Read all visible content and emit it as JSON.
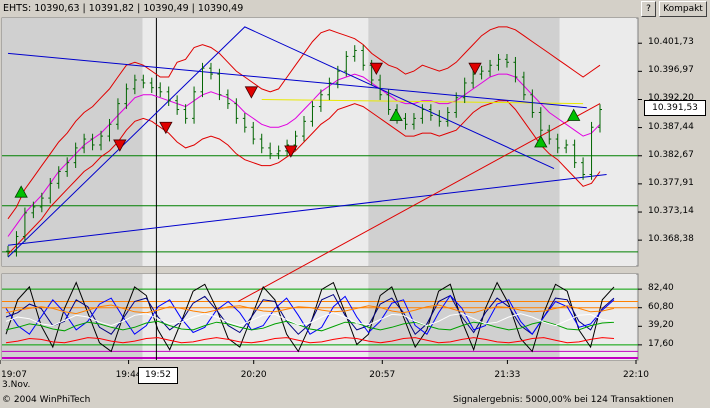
{
  "header": {
    "quote_text": "EHTS: 10390,63 | 10391,82 | 10390,49 | 10390,49",
    "help_label": "?",
    "compact_label": "Kompakt"
  },
  "price_marker": "10.391,53",
  "cursor_time": "19:52",
  "footer": {
    "date": "3.Nov.",
    "copyright": "© 2004 WinPhiTech",
    "signal_result": "Signalergebnis: 5000,00% bei 124 Transaktionen"
  },
  "colors": {
    "price_bars": "#006400",
    "bollinger": "#e00000",
    "trend": "#0000cc",
    "ma": "#e000e0",
    "buy_signal": "#00c000",
    "sell_signal": "#e00000"
  },
  "chart_data": {
    "type": "ohlc",
    "title": "",
    "xlabel": "",
    "ylabel": "",
    "x_ticks": [
      "19:07",
      "19:44",
      "20:20",
      "20:57",
      "21:33",
      "22:10"
    ],
    "y_ticks": [
      10401.73,
      10396.97,
      10392.2,
      10387.44,
      10382.67,
      10377.91,
      10373.14,
      10368.38
    ],
    "y_tick_labels": [
      "10.401,73",
      "10.396,97",
      "10.392,20",
      "10.387,44",
      "10.382,67",
      "10.377,91",
      "10.373,14",
      "10.368,38"
    ],
    "ylim": [
      10364.0,
      10406.0
    ],
    "sessions": [
      {
        "from": "19:07",
        "to": "19:48",
        "shade": "grey"
      },
      {
        "from": "19:48",
        "to": "20:53",
        "shade": "light"
      },
      {
        "from": "20:53",
        "to": "21:48",
        "shade": "grey"
      },
      {
        "from": "21:48",
        "to": "22:10",
        "shade": "light"
      }
    ],
    "cursor_x": "19:52",
    "price_series": [
      10366.5,
      10369,
      10373,
      10374,
      10375.5,
      10378,
      10380,
      10381.5,
      10384,
      10385.5,
      10384.5,
      10386,
      10388,
      10391.5,
      10394,
      10395.5,
      10395,
      10394.2,
      10393.5,
      10392,
      10390.5,
      10389,
      10393.5,
      10397.5,
      10396.5,
      10393,
      10391.5,
      10389,
      10387.5,
      10385.5,
      10384,
      10383,
      10383.5,
      10384.5,
      10386,
      10388.5,
      10391,
      10393,
      10395,
      10397,
      10399.5,
      10400.5,
      10398,
      10395.5,
      10393,
      10390.5,
      10389,
      10388,
      10389,
      10390.5,
      10389.5,
      10388.5,
      10390,
      10392.5,
      10395,
      10396.5,
      10397,
      10398,
      10399,
      10398.5,
      10396,
      10393,
      10390,
      10387,
      10385.5,
      10384,
      10384.5,
      10381.5,
      10379.5,
      10387.5,
      10390.5
    ],
    "bollinger_upper": [
      10372,
      10374,
      10377,
      10379,
      10381,
      10383,
      10385,
      10386.5,
      10388.5,
      10390,
      10391,
      10392.5,
      10394,
      10396,
      10398,
      10398.5,
      10398,
      10397,
      10396,
      10396,
      10398.5,
      10399,
      10401,
      10401.5,
      10401,
      10400,
      10398.5,
      10397,
      10396,
      10395,
      10394,
      10393.5,
      10394,
      10396,
      10398,
      10400,
      10402,
      10403.5,
      10404,
      10403.5,
      10403,
      10402.5,
      10401.5,
      10400,
      10399,
      10398,
      10397.5,
      10396.5,
      10397,
      10398,
      10397.5,
      10397,
      10397.5,
      10398.5,
      10400,
      10401.5,
      10403,
      10404,
      10404.5,
      10404.5,
      10404,
      10403,
      10402,
      10401,
      10400,
      10399,
      10398,
      10397,
      10396,
      10397,
      10398
    ],
    "bollinger_lower": [
      10366,
      10367.5,
      10369,
      10370.5,
      10372,
      10374,
      10375.5,
      10377,
      10378.5,
      10380,
      10381,
      10382.5,
      10383.5,
      10385,
      10387,
      10388.5,
      10389,
      10388.5,
      10387.5,
      10386.5,
      10385,
      10384,
      10384.5,
      10385.5,
      10386,
      10385.5,
      10384.5,
      10383,
      10382,
      10381.5,
      10381,
      10381,
      10381.5,
      10382.5,
      10383.5,
      10385,
      10386.5,
      10388,
      10389,
      10390.5,
      10391,
      10391.5,
      10391,
      10390,
      10389,
      10388,
      10387,
      10386,
      10386,
      10386.5,
      10386.5,
      10386,
      10386.5,
      10387,
      10388.5,
      10390,
      10391,
      10391.5,
      10392,
      10392,
      10390.5,
      10388.5,
      10386.5,
      10384.5,
      10383,
      10382,
      10380.5,
      10379,
      10377.5,
      10378,
      10380
    ],
    "moving_average": [
      10369,
      10371,
      10373,
      10374.5,
      10376,
      10378,
      10380,
      10381.5,
      10383,
      10384.5,
      10385.5,
      10386.5,
      10388,
      10389.5,
      10391,
      10392.5,
      10393,
      10393,
      10392.5,
      10392,
      10391.5,
      10391,
      10392,
      10393,
      10393.5,
      10393,
      10392.5,
      10391.5,
      10390,
      10389,
      10388,
      10387.5,
      10387.5,
      10388,
      10389,
      10390.5,
      10392,
      10393.5,
      10394.5,
      10395.5,
      10396,
      10396.5,
      10396,
      10395,
      10394,
      10393,
      10392,
      10391.5,
      10391.5,
      10392,
      10392,
      10391.5,
      10391.5,
      10392,
      10393,
      10394,
      10395,
      10396,
      10396.5,
      10396.5,
      10396,
      10394.5,
      10393,
      10391.5,
      10390,
      10389,
      10388,
      10387,
      10386,
      10386.5,
      10388
    ],
    "trend_lines": [
      {
        "color": "trend",
        "points": [
          [
            0,
            10365.5
          ],
          [
            36,
            10404.5
          ],
          [
            83,
            10380.5
          ]
        ]
      },
      {
        "color": "trend",
        "points": [
          [
            0,
            10400
          ],
          [
            88,
            10390.8
          ]
        ]
      },
      {
        "color": "trend",
        "points": [
          [
            0,
            10367.5
          ],
          [
            91,
            10379.5
          ]
        ]
      },
      {
        "color": "bollinger",
        "points": [
          [
            35,
            10358
          ],
          [
            90,
            10391.5
          ]
        ]
      }
    ],
    "signals": [
      {
        "type": "buy",
        "idx": 2,
        "price": 10376.5
      },
      {
        "type": "sell",
        "idx": 17,
        "price": 10384.5
      },
      {
        "type": "sell",
        "idx": 24,
        "price": 10387.5
      },
      {
        "type": "sell",
        "idx": 37,
        "price": 10393.5
      },
      {
        "type": "sell",
        "idx": 43,
        "price": 10383.5
      },
      {
        "type": "sell",
        "idx": 56,
        "price": 10397.5
      },
      {
        "type": "buy",
        "idx": 59,
        "price": 10389.5
      },
      {
        "type": "sell",
        "idx": 71,
        "price": 10397.5
      },
      {
        "type": "buy",
        "idx": 81,
        "price": 10385
      },
      {
        "type": "buy",
        "idx": 86,
        "price": 10389.5
      }
    ],
    "oscillator": {
      "y_ticks": [
        82.4,
        60.8,
        39.2,
        17.6
      ],
      "y_tick_labels": [
        "82,40",
        "60,80",
        "39,20",
        "17,60"
      ],
      "ylim": [
        0,
        100
      ],
      "lines": [
        {
          "color": "#000000",
          "values": [
            30,
            70,
            85,
            40,
            15,
            60,
            90,
            55,
            20,
            10,
            50,
            85,
            75,
            35,
            12,
            45,
            80,
            88,
            60,
            25,
            15,
            50,
            85,
            70,
            30,
            10,
            40,
            82,
            90,
            55,
            18,
            30,
            75,
            85,
            50,
            15,
            35,
            80,
            88,
            45,
            12,
            60,
            90,
            65,
            25,
            10,
            55,
            88,
            80,
            35,
            15,
            70,
            85
          ]
        },
        {
          "color": "#000080",
          "values": [
            50,
            55,
            65,
            60,
            40,
            45,
            70,
            62,
            38,
            30,
            48,
            68,
            72,
            50,
            35,
            45,
            66,
            74,
            58,
            40,
            32,
            50,
            70,
            68,
            45,
            30,
            42,
            70,
            76,
            52,
            35,
            40,
            65,
            72,
            55,
            30,
            42,
            68,
            75,
            50,
            32,
            55,
            72,
            62,
            40,
            30,
            50,
            72,
            70,
            45,
            35,
            60,
            72
          ]
        },
        {
          "color": "#0000ff",
          "values": [
            60,
            40,
            30,
            50,
            70,
            55,
            35,
            45,
            65,
            72,
            50,
            30,
            40,
            62,
            70,
            48,
            32,
            38,
            58,
            68,
            55,
            35,
            40,
            60,
            72,
            52,
            30,
            38,
            62,
            74,
            50,
            32,
            45,
            66,
            70,
            40,
            30,
            55,
            75,
            60,
            35,
            40,
            65,
            70,
            45,
            30,
            50,
            68,
            62,
            38,
            42,
            58,
            70
          ]
        },
        {
          "color": "#ff8000",
          "values": [
            55,
            58,
            60,
            62,
            60,
            56,
            54,
            58,
            62,
            64,
            60,
            56,
            55,
            58,
            62,
            60,
            57,
            55,
            58,
            62,
            63,
            60,
            57,
            56,
            59,
            62,
            61,
            58,
            56,
            57,
            60,
            63,
            61,
            57,
            55,
            58,
            62,
            64,
            60,
            56,
            55,
            59,
            62,
            61,
            58,
            56,
            57,
            60,
            63,
            60,
            56,
            57,
            60
          ]
        },
        {
          "color": "#00a000",
          "values": [
            35,
            38,
            42,
            40,
            36,
            34,
            40,
            44,
            42,
            38,
            35,
            38,
            43,
            45,
            40,
            36,
            35,
            40,
            44,
            42,
            38,
            35,
            37,
            42,
            45,
            41,
            36,
            34,
            39,
            44,
            43,
            38,
            35,
            38,
            42,
            44,
            40,
            36,
            35,
            40,
            44,
            42,
            38,
            35,
            37,
            42,
            45,
            41,
            36,
            35,
            40,
            43,
            44
          ]
        },
        {
          "color": "#ff0000",
          "values": [
            20,
            22,
            25,
            24,
            21,
            20,
            23,
            26,
            25,
            22,
            20,
            22,
            25,
            26,
            23,
            20,
            21,
            24,
            26,
            24,
            21,
            20,
            22,
            25,
            26,
            23,
            20,
            21,
            24,
            26,
            25,
            22,
            20,
            22,
            25,
            26,
            23,
            20,
            21,
            24,
            26,
            24,
            21,
            20,
            22,
            25,
            26,
            23,
            20,
            21,
            24,
            26,
            25
          ]
        },
        {
          "color": "#ffffff",
          "values": [
            45,
            50,
            48,
            42,
            40,
            46,
            52,
            50,
            44,
            40,
            45,
            52,
            54,
            48,
            42,
            44,
            50,
            54,
            50,
            44,
            40,
            46,
            52,
            53,
            47,
            41,
            43,
            50,
            55,
            50,
            43,
            41,
            47,
            53,
            52,
            45,
            40,
            45,
            52,
            54,
            48,
            42,
            44,
            50,
            54,
            50,
            44,
            40,
            46,
            52,
            53,
            47,
            45
          ]
        }
      ]
    }
  }
}
